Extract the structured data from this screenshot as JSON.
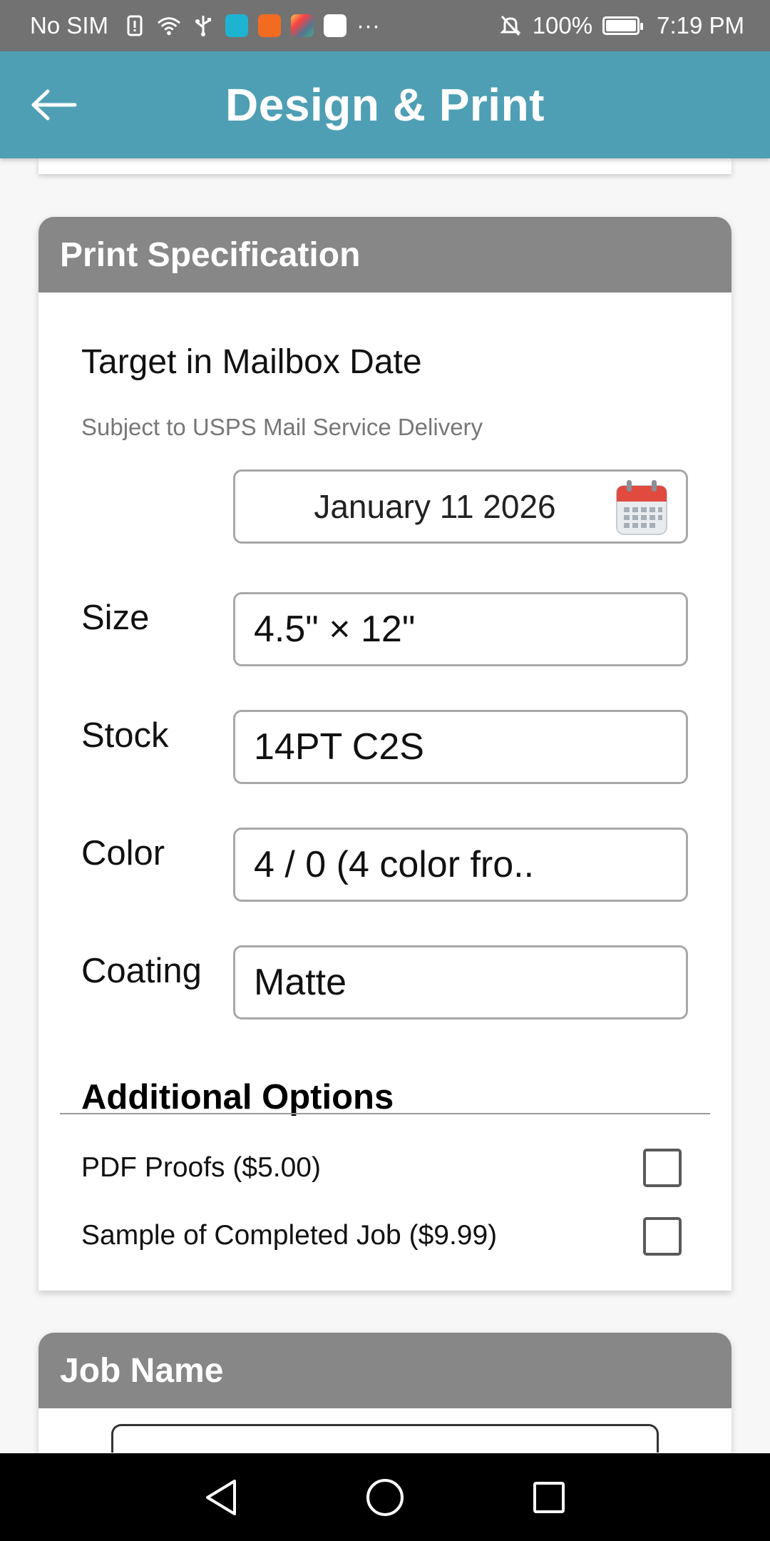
{
  "status_bar": {
    "carrier": "No SIM",
    "battery": "100%",
    "time": "7:19 PM",
    "more": "···"
  },
  "app_bar": {
    "title": "Design & Print"
  },
  "print_spec": {
    "header": "Print Specification",
    "target_label": "Target in Mailbox Date",
    "target_sub": "Subject to USPS Mail Service Delivery",
    "date_value": "January 11 2026",
    "fields": {
      "size": {
        "label": "Size",
        "value": "4.5\" × 12\""
      },
      "stock": {
        "label": "Stock",
        "value": "14PT C2S"
      },
      "color": {
        "label": "Color",
        "value": "4 / 0 (4 color fro.."
      },
      "coating": {
        "label": "Coating",
        "value": "Matte"
      }
    },
    "additional_title": "Additional Options",
    "options": [
      {
        "label": "PDF Proofs ($5.00)",
        "checked": false
      },
      {
        "label": "Sample of Completed Job ($9.99)",
        "checked": false
      }
    ]
  },
  "job_name": {
    "header": "Job Name"
  },
  "colors": {
    "app_bar": "#4f9fb4",
    "card_header": "#878787",
    "status_bar": "#727272",
    "calendar_red": "#e04a3f"
  },
  "icons": {
    "back": "arrow-left-icon",
    "calendar": "calendar-icon",
    "nav_back": "triangle-back-icon",
    "nav_home": "circle-home-icon",
    "nav_recents": "square-recents-icon"
  }
}
